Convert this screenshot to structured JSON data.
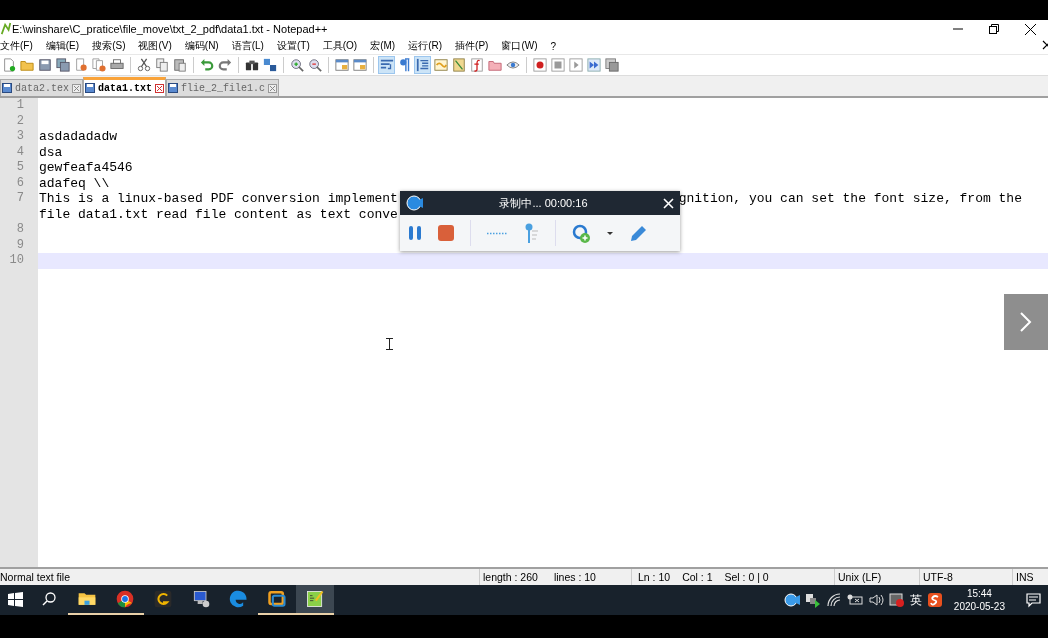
{
  "window": {
    "title": "E:\\winshare\\C_pratice\\file_move\\txt_2_pdf\\data1.txt - Notepad++"
  },
  "menu": [
    "文件(F)",
    "编辑(E)",
    "搜索(S)",
    "视图(V)",
    "编码(N)",
    "语言(L)",
    "设置(T)",
    "工具(O)",
    "宏(M)",
    "运行(R)",
    "插件(P)",
    "窗口(W)",
    "?"
  ],
  "toolbar_groups": [
    {
      "buttons": [
        {
          "kind": "new",
          "pressed": false
        },
        {
          "kind": "open",
          "pressed": false
        },
        {
          "kind": "save",
          "pressed": false
        },
        {
          "kind": "saveall",
          "pressed": false
        },
        {
          "kind": "close",
          "pressed": false
        },
        {
          "kind": "closeall",
          "pressed": false
        },
        {
          "kind": "print",
          "pressed": false
        }
      ]
    },
    {
      "buttons": [
        {
          "kind": "cut",
          "pressed": false
        },
        {
          "kind": "copy",
          "pressed": false
        },
        {
          "kind": "paste",
          "pressed": false
        }
      ]
    },
    {
      "buttons": [
        {
          "kind": "undo",
          "pressed": false
        },
        {
          "kind": "redo",
          "pressed": false
        }
      ]
    },
    {
      "buttons": [
        {
          "kind": "find",
          "pressed": false
        },
        {
          "kind": "replace",
          "pressed": false
        }
      ]
    },
    {
      "buttons": [
        {
          "kind": "zoomin",
          "pressed": false
        },
        {
          "kind": "zoomout",
          "pressed": false
        }
      ]
    },
    {
      "buttons": [
        {
          "kind": "syncv",
          "pressed": false
        },
        {
          "kind": "synch",
          "pressed": false
        }
      ]
    },
    {
      "buttons": [
        {
          "kind": "wrap",
          "pressed": true
        },
        {
          "kind": "pilcrow",
          "pressed": false
        },
        {
          "kind": "indent",
          "pressed": true
        },
        {
          "kind": "panel",
          "pressed": false
        },
        {
          "kind": "map",
          "pressed": false
        },
        {
          "kind": "function",
          "pressed": false
        },
        {
          "kind": "folder2",
          "pressed": false
        },
        {
          "kind": "eye",
          "pressed": false
        }
      ]
    },
    {
      "buttons": [
        {
          "kind": "record",
          "pressed": false
        },
        {
          "kind": "stop",
          "pressed": false
        },
        {
          "kind": "play",
          "pressed": false
        },
        {
          "kind": "playmulti",
          "pressed": false
        },
        {
          "kind": "savemacro",
          "pressed": false
        }
      ]
    }
  ],
  "tabs": [
    {
      "label": "data2.tex",
      "selected": false
    },
    {
      "label": "data1.txt",
      "selected": true
    },
    {
      "label": "flie_2_file1.c",
      "selected": false
    }
  ],
  "editor": {
    "lines": [
      {
        "number": "1",
        "current": false
      },
      {
        "number": "2",
        "current": false
      },
      {
        "number": "3",
        "current": false,
        "text": "asdadadadw"
      },
      {
        "number": "4",
        "current": false,
        "text": "dsa"
      },
      {
        "number": "5",
        "current": false,
        "text": "gewfeafa4546"
      },
      {
        "number": "6",
        "current": false,
        "text": "adafeq \\\\"
      },
      {
        "number": "7",
        "current": false,
        "rows": [
          {
            "parts": [
              "This is a linux-based PDF conversion implement",
              "gnition, you can set the font size, from the"
            ]
          },
          {
            "parts": [
              "file data1.txt read file content as text conve"
            ]
          }
        ]
      },
      {
        "number": "8",
        "current": false
      },
      {
        "number": "9",
        "current": false
      },
      {
        "number": "10",
        "current": true
      }
    ]
  },
  "recorder": {
    "title": "录制中... 00:00:16"
  },
  "status_bar": {
    "file_type": "Normal text file",
    "length": "length : 260",
    "lines": "lines : 10",
    "ln": "Ln : 10",
    "col": "Col : 1",
    "sel": "Sel : 0 | 0",
    "eol": "Unix (LF)",
    "encoding": "UTF-8",
    "mode": "INS"
  },
  "taskbar": {
    "apps": [
      {
        "kind": "explorer",
        "running": true,
        "selected": false
      },
      {
        "kind": "chrome",
        "running": true,
        "selected": false
      },
      {
        "kind": "gapp",
        "running": false,
        "selected": false
      },
      {
        "kind": "computer",
        "running": false,
        "selected": false
      },
      {
        "kind": "edge",
        "running": false,
        "selected": false
      },
      {
        "kind": "vm",
        "running": true,
        "selected": false
      },
      {
        "kind": "notepad",
        "running": true,
        "selected": true
      }
    ],
    "ime": "英",
    "time": "15:44",
    "date": "2020-05-23"
  }
}
